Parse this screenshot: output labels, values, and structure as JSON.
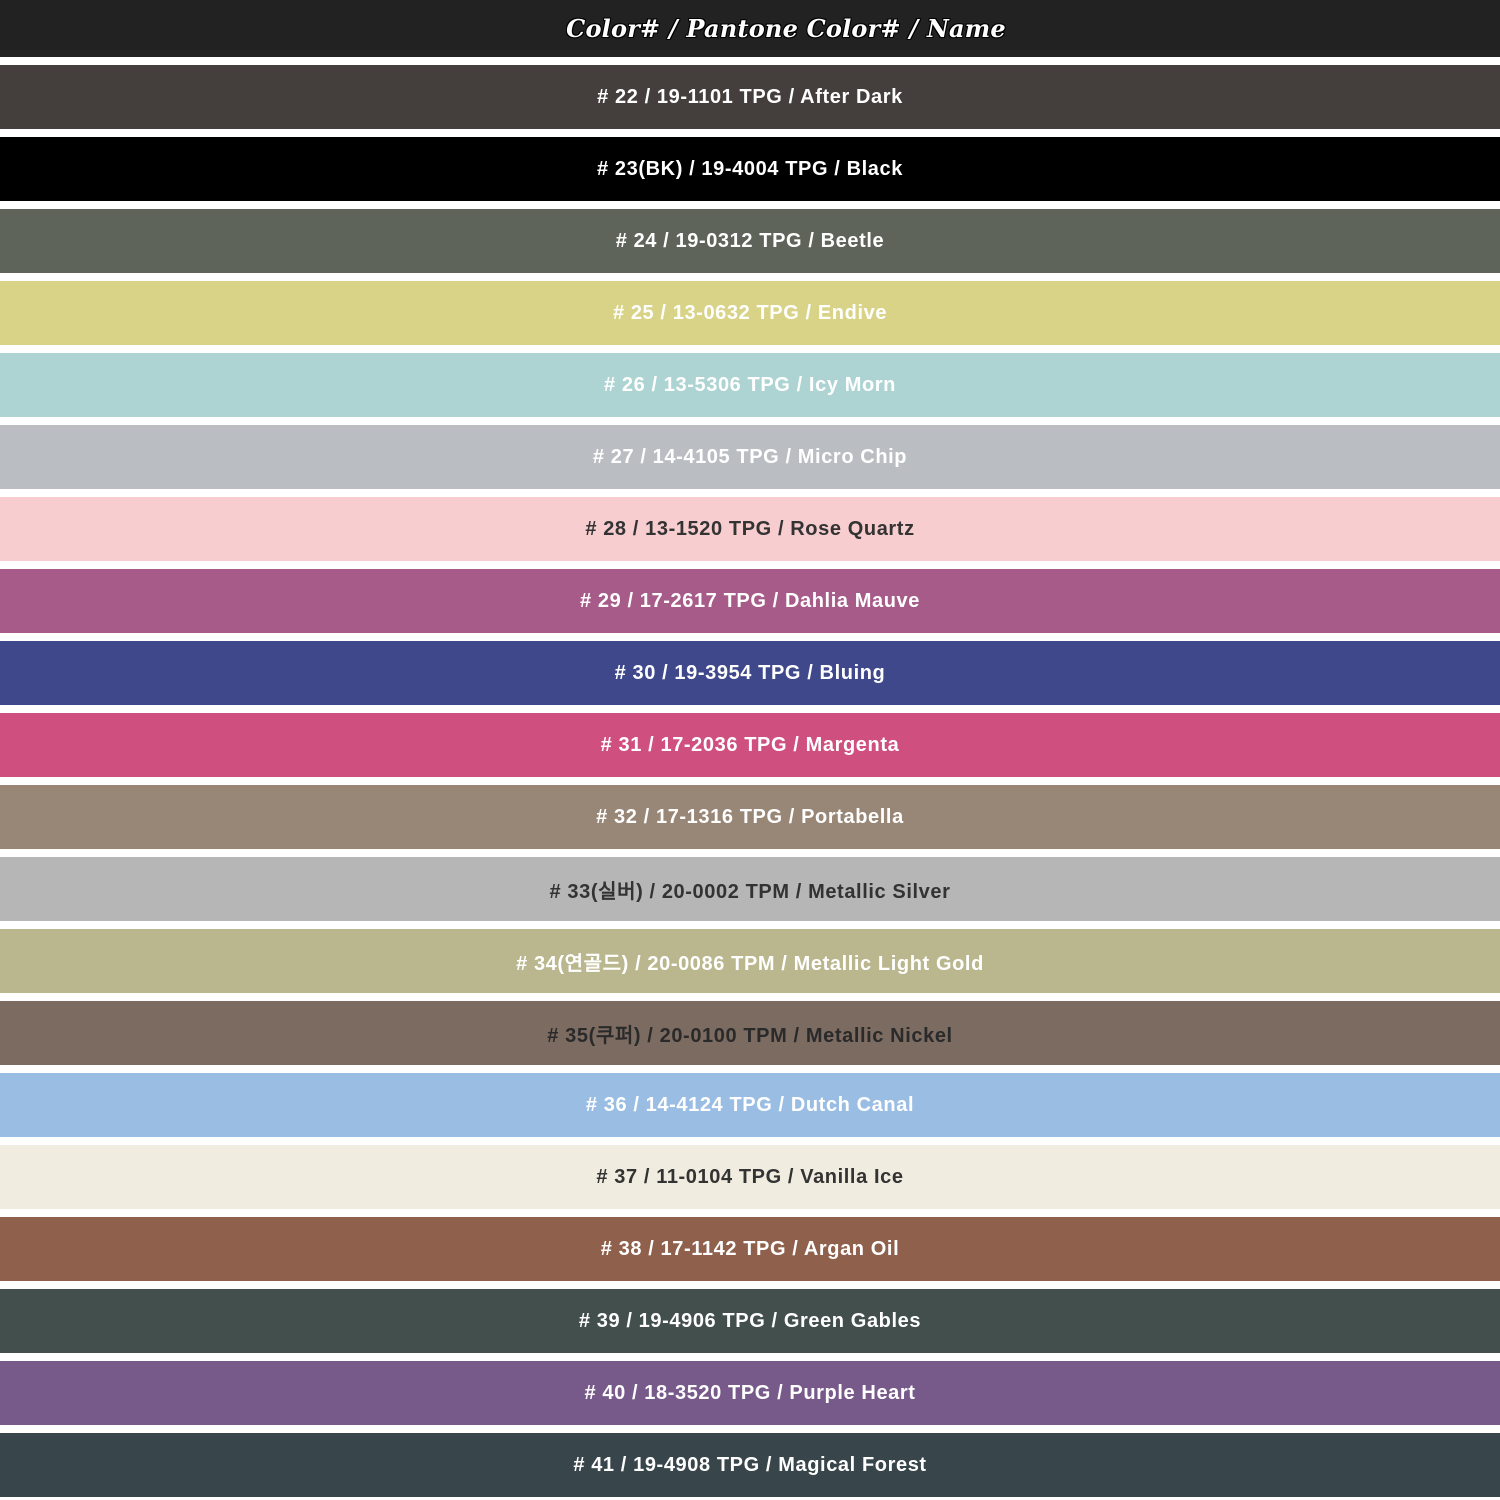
{
  "header": {
    "title": "Color# / Pantone Color# / Name",
    "background": "#222222",
    "text_color": "#ffffff"
  },
  "page_background": "#ffffff",
  "swatches": [
    {
      "label": "# 22 / 19-1101 TPG  / After Dark",
      "color": "#443f3d",
      "text_color": "#ffffff"
    },
    {
      "label": "# 23(BK) / 19-4004 TPG / Black",
      "color": "#000000",
      "text_color": "#ffffff"
    },
    {
      "label": "# 24 / 19-0312 TPG / Beetle",
      "color": "#5e6459",
      "text_color": "#ffffff"
    },
    {
      "label": "# 25 / 13-0632 TPG / Endive",
      "color": "#d8d387",
      "text_color": "#ffffff"
    },
    {
      "label": "# 26 / 13-5306 TPG / Icy Morn",
      "color": "#add4d2",
      "text_color": "#ffffff"
    },
    {
      "label": "# 27 / 14-4105 TPG  / Micro Chip",
      "color": "#babdc2",
      "text_color": "#ffffff"
    },
    {
      "label": "# 28 / 13-1520 TPG / Rose Quartz",
      "color": "#f7cdcf",
      "text_color": "#333333"
    },
    {
      "label": "# 29 / 17-2617 TPG / Dahlia Mauve",
      "color": "#a75b88",
      "text_color": "#ffffff"
    },
    {
      "label": "# 30 / 19-3954 TPG  / Bluing",
      "color": "#3e488a",
      "text_color": "#ffffff"
    },
    {
      "label": "# 31 / 17-2036 TPG / Margenta",
      "color": "#cf4f7f",
      "text_color": "#ffffff"
    },
    {
      "label": "# 32 / 17-1316 TPG / Portabella",
      "color": "#988676",
      "text_color": "#ffffff"
    },
    {
      "label": "# 33(실버) / 20-0002 TPM / Metallic Silver",
      "color": "#b5b6b5",
      "text_color": "#333333"
    },
    {
      "label": "# 34(연골드) / 20-0086 TPM / Metallic Light Gold",
      "color": "#bab68e",
      "text_color": "#ffffff"
    },
    {
      "label": "# 35(쿠퍼) / 20-0100 TPM / Metallic Nickel",
      "color": "#7c6b61",
      "text_color": "#2a2a2a"
    },
    {
      "label": "# 36 / 14-4124 TPG  / Dutch Canal",
      "color": "#9abde4",
      "text_color": "#ffffff"
    },
    {
      "label": "# 37 / 11-0104 TPG  / Vanilla Ice",
      "color": "#f1ece0",
      "text_color": "#333333"
    },
    {
      "label": "# 38 / 17-1142 TPG / Argan Oil",
      "color": "#8f614c",
      "text_color": "#ffffff"
    },
    {
      "label": "# 39 / 19-4906 TPG / Green Gables",
      "color": "#434f4d",
      "text_color": "#ffffff"
    },
    {
      "label": "# 40 / 18-3520 TPG / Purple Heart",
      "color": "#775a8a",
      "text_color": "#ffffff"
    },
    {
      "label": "# 41 / 19-4908 TPG / Magical Forest",
      "color": "#38454a",
      "text_color": "#ffffff"
    }
  ]
}
